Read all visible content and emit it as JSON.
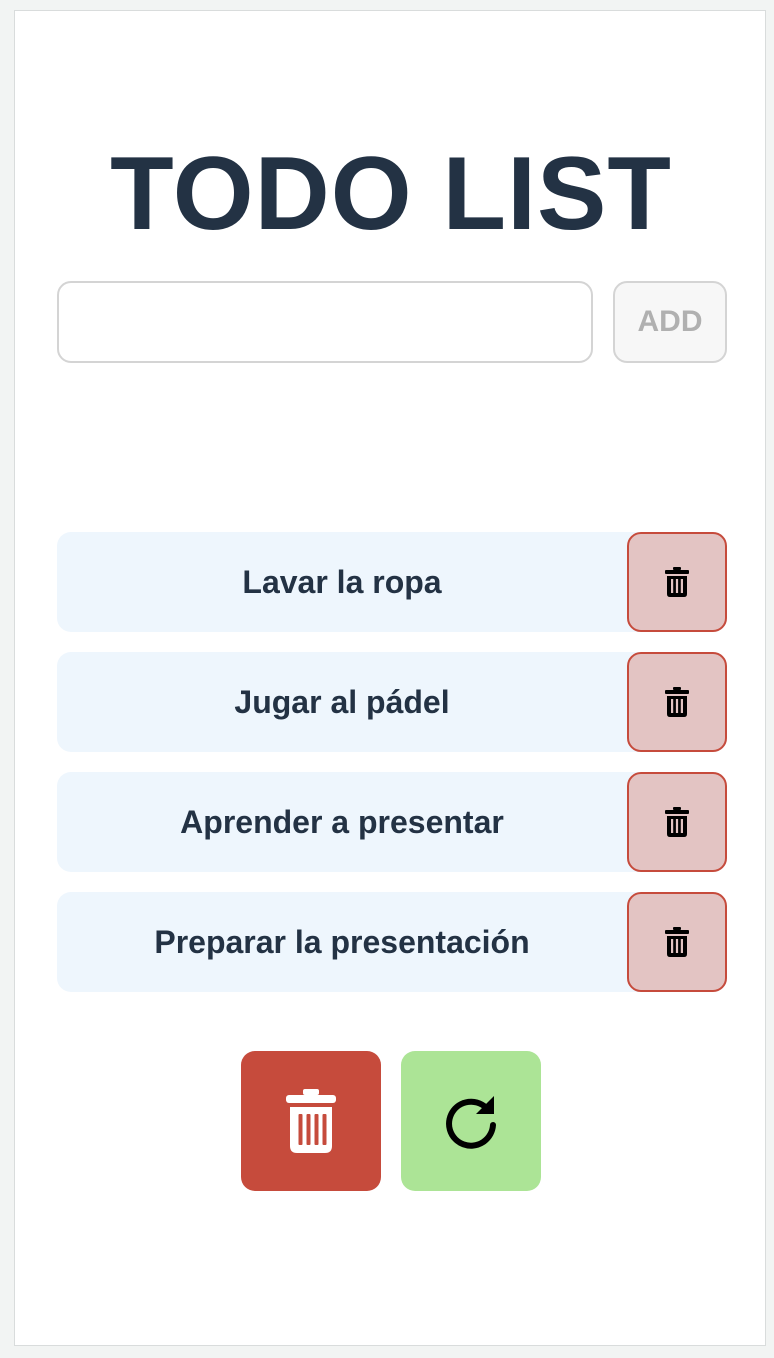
{
  "header": {
    "title": "TODO LIST"
  },
  "form": {
    "input_value": "",
    "input_placeholder": "",
    "add_label": "ADD"
  },
  "todos": [
    {
      "text": "Lavar la ropa",
      "delete_icon": "trash-icon"
    },
    {
      "text": "Jugar al pádel",
      "delete_icon": "trash-icon"
    },
    {
      "text": "Aprender a presentar",
      "delete_icon": "trash-icon"
    },
    {
      "text": "Preparar la presentación",
      "delete_icon": "trash-icon"
    }
  ],
  "actions": {
    "clear_all_icon": "trash-icon",
    "reset_icon": "refresh-icon"
  },
  "colors": {
    "title": "#233244",
    "item_background": "#eef6fd",
    "delete_background": "#e3c4c3",
    "delete_border": "#c64b3c",
    "clear_button": "#c64b3c",
    "reset_button": "#ace496"
  }
}
